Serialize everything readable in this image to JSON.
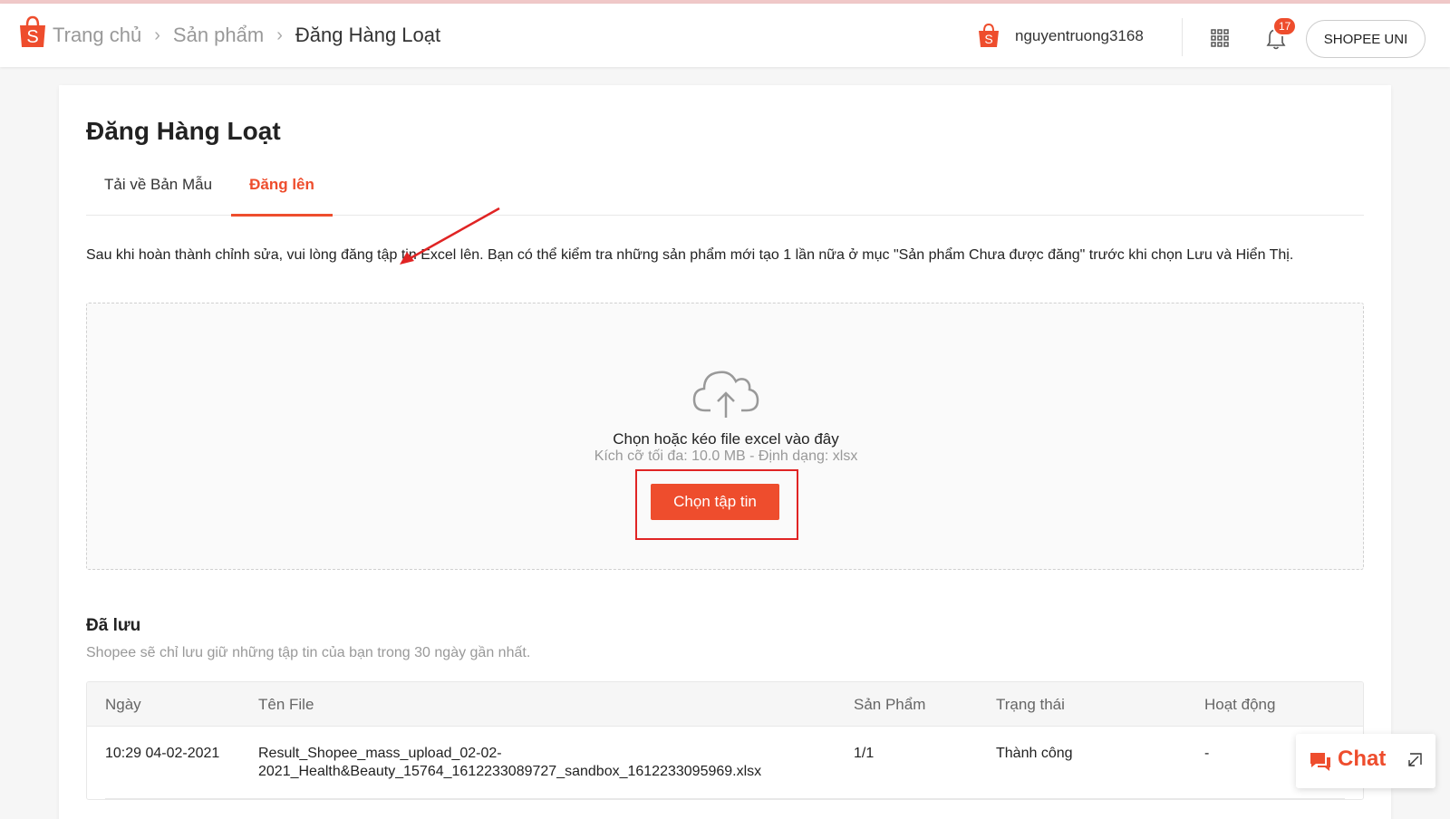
{
  "header": {
    "breadcrumbs": [
      "Trang chủ",
      "Sản phẩm",
      "Đăng Hàng Loạt"
    ],
    "username": "nguyentruong3168",
    "notification_count": "17",
    "shopee_uni_label": "SHOPEE UNI"
  },
  "page": {
    "title": "Đăng Hàng Loạt",
    "tabs": [
      {
        "label": "Tải về Bản Mẫu",
        "active": false
      },
      {
        "label": "Đăng lên",
        "active": true
      }
    ],
    "instruction": "Sau khi hoàn thành chỉnh sửa, vui lòng đăng tập tin Excel lên. Bạn có thể kiểm tra những sản phẩm mới tạo 1 lần nữa ở mục \"Sản phẩm Chưa được đăng\" trước khi chọn Lưu và Hiển Thị."
  },
  "dropzone": {
    "text": "Chọn hoặc kéo file excel vào đây",
    "hint": "Kích cỡ tối đa: 10.0 MB - Định dạng: xlsx",
    "button_label": "Chọn tập tin",
    "icon": "cloud-upload-icon"
  },
  "saved": {
    "title": "Đã lưu",
    "description": "Shopee sẽ chỉ lưu giữ những tập tin của bạn trong 30 ngày gần nhất.",
    "columns": [
      "Ngày",
      "Tên File",
      "Sản Phẩm",
      "Trạng thái",
      "Hoạt động"
    ],
    "rows": [
      {
        "date": "10:29 04-02-2021",
        "file_line1": "Result_Shopee_mass_upload_02-02-",
        "file_line2": "2021_Health&Beauty_15764_1612233089727_sandbox_1612233095969.xlsx",
        "products": "1/1",
        "status": "Thành công",
        "action": "-"
      }
    ]
  },
  "chat": {
    "label": "Chat"
  },
  "colors": {
    "brand": "#ee4d2d",
    "annotation": "#e02424"
  }
}
